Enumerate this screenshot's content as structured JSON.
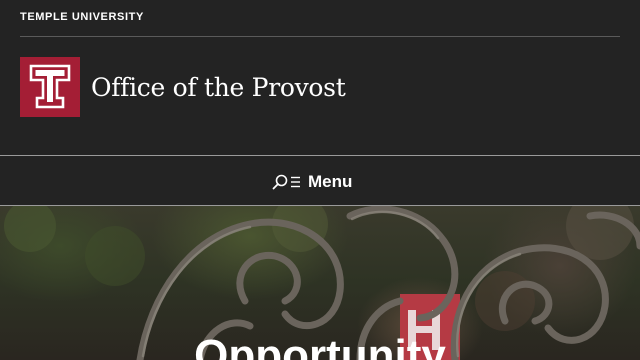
{
  "topbar": {
    "university_link": "TEMPLE UNIVERSITY"
  },
  "header": {
    "site_title": "Office of the Provost",
    "logo_icon": "temple-t-logo-icon"
  },
  "nav": {
    "menu_label": "Menu",
    "search_icon": "search-icon",
    "menu_icon": "hamburger-icon"
  },
  "hero": {
    "heading": "Opportunity"
  },
  "colors": {
    "background": "#232323",
    "brand_red": "#a41e35",
    "text": "#ffffff"
  }
}
